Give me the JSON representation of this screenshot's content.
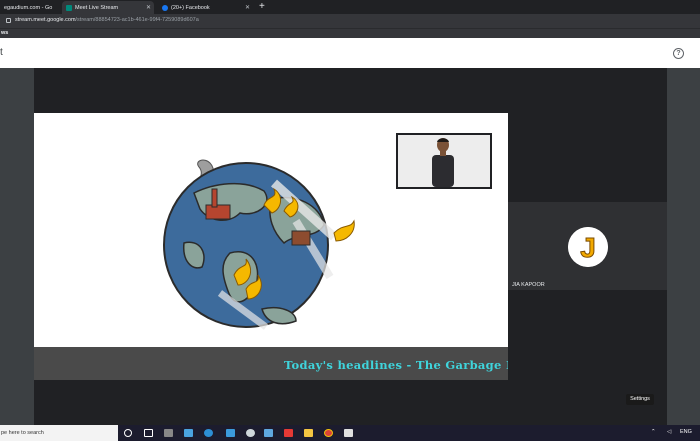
{
  "browser": {
    "tabs": [
      {
        "label": "egaudium.com - Go",
        "active": false
      },
      {
        "label": "Meet Live Stream",
        "active": true
      },
      {
        "label": "(20+) Facebook",
        "active": false
      }
    ],
    "new_tab_symbol": "+",
    "url_host": "stream.meet.google.com",
    "url_path": "/stream/88854723-ac1b-461e-99f4-7259089d607a",
    "bookmark_label": "ws"
  },
  "app": {
    "title_fragment": "t",
    "help_symbol": "?"
  },
  "stage": {
    "ticker_text": "Today's headlines - The Garbage Patc"
  },
  "participants": [
    {
      "name": "JIA KAPOOR",
      "avatar_letter": "J"
    }
  ],
  "controls": {
    "settings_label": "Settings"
  },
  "taskbar": {
    "search_placeholder": "pe here to search",
    "tray_language": "ENG",
    "colors": {
      "background": "#1c1c2e"
    }
  },
  "colors": {
    "ticker_text": "#3fd4dc",
    "ticker_bg": "#4a4a4a",
    "page_bg": "#202124"
  }
}
